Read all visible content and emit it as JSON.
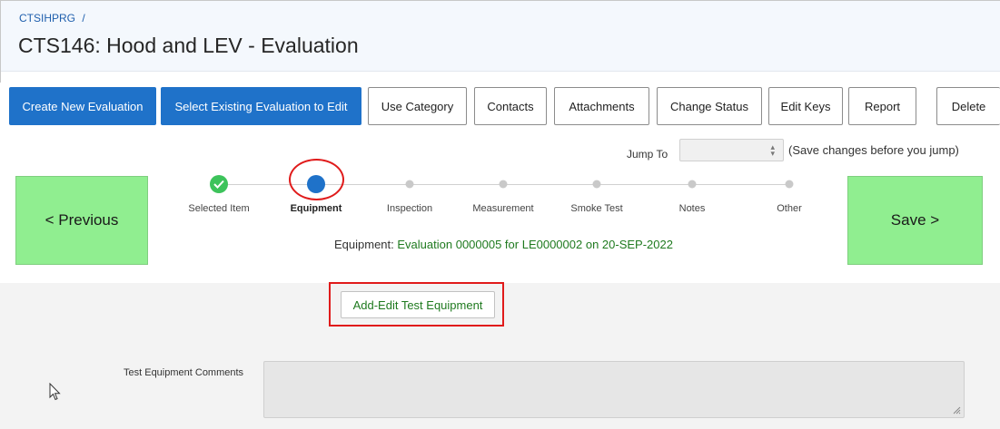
{
  "header": {
    "breadcrumb": "CTSIHPRG",
    "breadcrumb_sep": "/",
    "title": "CTS146: Hood and LEV - Evaluation"
  },
  "toolbar": {
    "create_new": "Create New Evaluation",
    "select_existing": "Select Existing Evaluation to Edit",
    "use_category": "Use Category",
    "contacts": "Contacts",
    "attachments": "Attachments",
    "change_status": "Change Status",
    "edit_keys": "Edit Keys",
    "report": "Report",
    "delete": "Delete"
  },
  "jump": {
    "label": "Jump To",
    "selected": "",
    "note": "(Save changes before you jump)"
  },
  "nav": {
    "previous": "< Previous",
    "save": "Save >"
  },
  "steps": [
    {
      "label": "Selected Item",
      "state": "done"
    },
    {
      "label": "Equipment",
      "state": "current"
    },
    {
      "label": "Inspection",
      "state": "todo"
    },
    {
      "label": "Measurement",
      "state": "todo"
    },
    {
      "label": "Smoke Test",
      "state": "todo"
    },
    {
      "label": "Notes",
      "state": "todo"
    },
    {
      "label": "Other",
      "state": "todo"
    }
  ],
  "equipment_line": {
    "prefix": "Equipment:",
    "value": "Evaluation 0000005 for LE0000002 on 20-SEP-2022"
  },
  "lower": {
    "add_edit_button": "Add-Edit Test Equipment",
    "comments_label": "Test Equipment Comments",
    "comments_value": ""
  },
  "colors": {
    "primary": "#1f72c9",
    "nav_green": "#90ee90",
    "done_green": "#3dc35b",
    "highlight_red": "#e01b1b",
    "link_green": "#1f7a1f"
  }
}
